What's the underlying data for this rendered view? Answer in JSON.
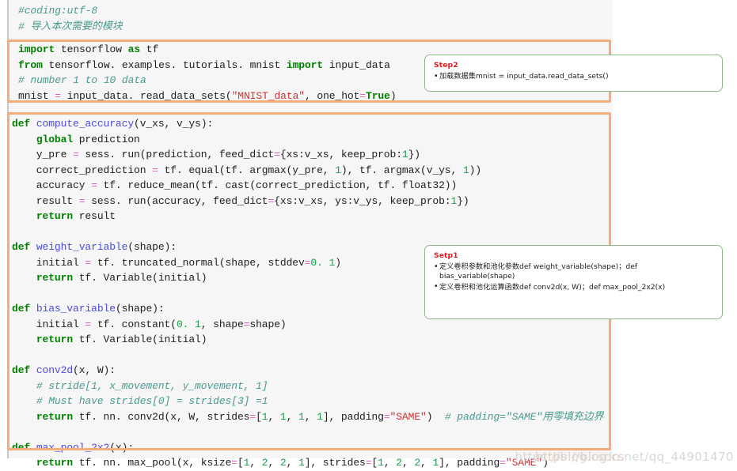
{
  "document": {
    "kind": "python-source-screenshot",
    "watermark": "https://blog.csdn.net/qq_44901470",
    "watermark_prefix": "https://blog.cs"
  },
  "code": {
    "header_lines": [
      [
        {
          "t": "com",
          "v": "#coding:utf-8"
        }
      ],
      [
        {
          "t": "com",
          "v": "# 导入本次需要的模块"
        }
      ]
    ],
    "import_lines": [
      [
        {
          "t": "kw",
          "v": "import"
        },
        {
          "t": "pl",
          "v": " tensorflow "
        },
        {
          "t": "kw",
          "v": "as"
        },
        {
          "t": "pl",
          "v": " tf"
        }
      ],
      [
        {
          "t": "kw",
          "v": "from"
        },
        {
          "t": "pl",
          "v": " tensorflow. examples. tutorials. mnist "
        },
        {
          "t": "kw",
          "v": "import"
        },
        {
          "t": "pl",
          "v": " input_data"
        }
      ],
      [
        {
          "t": "com",
          "v": "# number 1 to 10 data"
        }
      ],
      [
        {
          "t": "pl",
          "v": "mnist "
        },
        {
          "t": "op",
          "v": "="
        },
        {
          "t": "pl",
          "v": " input_data. read_data_sets("
        },
        {
          "t": "str",
          "v": "\"MNIST_data\""
        },
        {
          "t": "pl",
          "v": ", one_hot"
        },
        {
          "t": "op",
          "v": "="
        },
        {
          "t": "kw",
          "v": "True"
        },
        {
          "t": "pl",
          "v": ")"
        }
      ]
    ],
    "def_lines": [
      [
        {
          "t": "kw",
          "v": "def"
        },
        {
          "t": "pl",
          "v": " "
        },
        {
          "t": "fn",
          "v": "compute_accuracy"
        },
        {
          "t": "pl",
          "v": "(v_xs, v_ys):"
        }
      ],
      [
        {
          "t": "pl",
          "v": "    "
        },
        {
          "t": "kw",
          "v": "global"
        },
        {
          "t": "pl",
          "v": " prediction"
        }
      ],
      [
        {
          "t": "pl",
          "v": "    y_pre "
        },
        {
          "t": "op",
          "v": "="
        },
        {
          "t": "pl",
          "v": " sess. run(prediction, feed_dict"
        },
        {
          "t": "op",
          "v": "="
        },
        {
          "t": "pl",
          "v": "{xs:v_xs, keep_prob:"
        },
        {
          "t": "num",
          "v": "1"
        },
        {
          "t": "pl",
          "v": "})"
        }
      ],
      [
        {
          "t": "pl",
          "v": "    correct_prediction "
        },
        {
          "t": "op",
          "v": "="
        },
        {
          "t": "pl",
          "v": " tf. equal(tf. argmax(y_pre, "
        },
        {
          "t": "num",
          "v": "1"
        },
        {
          "t": "pl",
          "v": "), tf. argmax(v_ys, "
        },
        {
          "t": "num",
          "v": "1"
        },
        {
          "t": "pl",
          "v": "))"
        }
      ],
      [
        {
          "t": "pl",
          "v": "    accuracy "
        },
        {
          "t": "op",
          "v": "="
        },
        {
          "t": "pl",
          "v": " tf. reduce_mean(tf. cast(correct_prediction, tf. float32))"
        }
      ],
      [
        {
          "t": "pl",
          "v": "    result "
        },
        {
          "t": "op",
          "v": "="
        },
        {
          "t": "pl",
          "v": " sess. run(accuracy, feed_dict"
        },
        {
          "t": "op",
          "v": "="
        },
        {
          "t": "pl",
          "v": "{xs:v_xs, ys:v_ys, keep_prob:"
        },
        {
          "t": "num",
          "v": "1"
        },
        {
          "t": "pl",
          "v": "})"
        }
      ],
      [
        {
          "t": "pl",
          "v": "    "
        },
        {
          "t": "kw",
          "v": "return"
        },
        {
          "t": "pl",
          "v": " result"
        }
      ],
      [
        {
          "t": "pl",
          "v": ""
        }
      ],
      [
        {
          "t": "kw",
          "v": "def"
        },
        {
          "t": "pl",
          "v": " "
        },
        {
          "t": "fn",
          "v": "weight_variable"
        },
        {
          "t": "pl",
          "v": "(shape):"
        }
      ],
      [
        {
          "t": "pl",
          "v": "    initial "
        },
        {
          "t": "op",
          "v": "="
        },
        {
          "t": "pl",
          "v": " tf. truncated_normal(shape, stddev"
        },
        {
          "t": "op",
          "v": "="
        },
        {
          "t": "num",
          "v": "0. 1"
        },
        {
          "t": "pl",
          "v": ")"
        }
      ],
      [
        {
          "t": "pl",
          "v": "    "
        },
        {
          "t": "kw",
          "v": "return"
        },
        {
          "t": "pl",
          "v": " tf. Variable(initial)"
        }
      ],
      [
        {
          "t": "pl",
          "v": ""
        }
      ],
      [
        {
          "t": "kw",
          "v": "def"
        },
        {
          "t": "pl",
          "v": " "
        },
        {
          "t": "fn",
          "v": "bias_variable"
        },
        {
          "t": "pl",
          "v": "(shape):"
        }
      ],
      [
        {
          "t": "pl",
          "v": "    initial "
        },
        {
          "t": "op",
          "v": "="
        },
        {
          "t": "pl",
          "v": " tf. constant("
        },
        {
          "t": "num",
          "v": "0. 1"
        },
        {
          "t": "pl",
          "v": ", shape"
        },
        {
          "t": "op",
          "v": "="
        },
        {
          "t": "pl",
          "v": "shape)"
        }
      ],
      [
        {
          "t": "pl",
          "v": "    "
        },
        {
          "t": "kw",
          "v": "return"
        },
        {
          "t": "pl",
          "v": " tf. Variable(initial)"
        }
      ],
      [
        {
          "t": "pl",
          "v": ""
        }
      ],
      [
        {
          "t": "kw",
          "v": "def"
        },
        {
          "t": "pl",
          "v": " "
        },
        {
          "t": "fn",
          "v": "conv2d"
        },
        {
          "t": "pl",
          "v": "(x, W):"
        }
      ],
      [
        {
          "t": "pl",
          "v": "    "
        },
        {
          "t": "com",
          "v": "# stride[1, x_movement, y_movement, 1]"
        }
      ],
      [
        {
          "t": "pl",
          "v": "    "
        },
        {
          "t": "com",
          "v": "# Must have strides[0] = strides[3] =1"
        }
      ],
      [
        {
          "t": "pl",
          "v": "    "
        },
        {
          "t": "kw",
          "v": "return"
        },
        {
          "t": "pl",
          "v": " tf. nn. conv2d(x, W, strides"
        },
        {
          "t": "op",
          "v": "="
        },
        {
          "t": "pl",
          "v": "["
        },
        {
          "t": "num",
          "v": "1"
        },
        {
          "t": "pl",
          "v": ", "
        },
        {
          "t": "num",
          "v": "1"
        },
        {
          "t": "pl",
          "v": ", "
        },
        {
          "t": "num",
          "v": "1"
        },
        {
          "t": "pl",
          "v": ", "
        },
        {
          "t": "num",
          "v": "1"
        },
        {
          "t": "pl",
          "v": "], padding"
        },
        {
          "t": "op",
          "v": "="
        },
        {
          "t": "str",
          "v": "\"SAME\""
        },
        {
          "t": "pl",
          "v": ")  "
        },
        {
          "t": "com",
          "v": "# padding=\"SAME\"用零填充边界"
        }
      ],
      [
        {
          "t": "pl",
          "v": ""
        }
      ],
      [
        {
          "t": "kw",
          "v": "def"
        },
        {
          "t": "pl",
          "v": " "
        },
        {
          "t": "fn",
          "v": "max_pool_2x2"
        },
        {
          "t": "pl",
          "v": "(x):"
        }
      ],
      [
        {
          "t": "pl",
          "v": "    "
        },
        {
          "t": "kw",
          "v": "return"
        },
        {
          "t": "pl",
          "v": " tf. nn. max_pool(x, ksize"
        },
        {
          "t": "op",
          "v": "="
        },
        {
          "t": "pl",
          "v": "["
        },
        {
          "t": "num",
          "v": "1"
        },
        {
          "t": "pl",
          "v": ", "
        },
        {
          "t": "num",
          "v": "2"
        },
        {
          "t": "pl",
          "v": ", "
        },
        {
          "t": "num",
          "v": "2"
        },
        {
          "t": "pl",
          "v": ", "
        },
        {
          "t": "num",
          "v": "1"
        },
        {
          "t": "pl",
          "v": "], strides"
        },
        {
          "t": "op",
          "v": "="
        },
        {
          "t": "pl",
          "v": "["
        },
        {
          "t": "num",
          "v": "1"
        },
        {
          "t": "pl",
          "v": ", "
        },
        {
          "t": "num",
          "v": "2"
        },
        {
          "t": "pl",
          "v": ", "
        },
        {
          "t": "num",
          "v": "2"
        },
        {
          "t": "pl",
          "v": ", "
        },
        {
          "t": "num",
          "v": "1"
        },
        {
          "t": "pl",
          "v": "], padding"
        },
        {
          "t": "op",
          "v": "="
        },
        {
          "t": "str",
          "v": "\"SAME\""
        },
        {
          "t": "pl",
          "v": ")"
        }
      ]
    ]
  },
  "callouts": {
    "step2": {
      "title": "Step2",
      "items": [
        "加载数据集mnist = input_data.read_data_sets()"
      ]
    },
    "setp1": {
      "title": "Setp1",
      "items": [
        "定义卷积参数和池化参数def weight_variable(shape)；def bias_variable(shape)",
        "定义卷积和池化运算函数def conv2d(x, W)；def max_pool_2x2(x)"
      ]
    }
  },
  "colors": {
    "highlight_border": "#f4ac7c",
    "callout_border": "#8cba87",
    "callout_title": "#e01b24",
    "keyword": "#008000",
    "function_name": "#4a4ae0",
    "string": "#cf3333",
    "comment": "#4a9a8e",
    "number": "#16a04a",
    "operator": "#e060c0",
    "code_background": "#f6f6f6"
  }
}
